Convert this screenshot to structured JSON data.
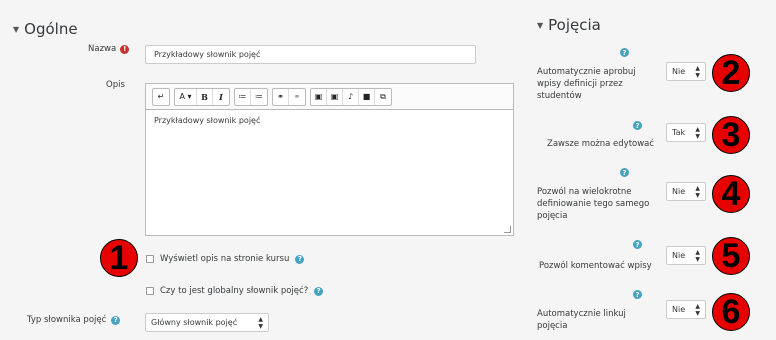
{
  "general": {
    "title": "Ogólne",
    "name_label": "Nazwa",
    "name_value": "Przykładowy słownik pojęć",
    "desc_label": "Opis",
    "desc_value": "Przykładowy słownik pojęć",
    "toolbar": [
      "↵",
      "A ▾",
      "B",
      "I",
      "≔",
      "≔",
      "⚭",
      "⚭",
      "▣",
      "▣",
      "♪",
      "■",
      "⧉"
    ],
    "show_desc_label": "Wyświetl opis na stronie kursu",
    "global_label": "Czy to jest globalny słownik pojęć?",
    "type_label": "Typ słownika pojęć",
    "type_value": "Główny słownik pojęć"
  },
  "entries": {
    "title": "Pojęcia",
    "items": [
      {
        "label": "Automatycznie aprobuj wpisy definicji przez studentów",
        "value": "Nie",
        "badge": "2"
      },
      {
        "label": "Zawsze można edytować",
        "value": "Tak",
        "badge": "3"
      },
      {
        "label": "Pozwól na wielokrotne definiowanie tego samego pojęcia",
        "value": "Nie",
        "badge": "4"
      },
      {
        "label": "Pozwól komentować wpisy",
        "value": "Nie",
        "badge": "5"
      },
      {
        "label": "Automatycznie linkuj pojęcia",
        "value": "Nie",
        "badge": "6"
      }
    ]
  },
  "badge1": "1",
  "colors": {
    "help": "#45a3c2",
    "required": "#c9302c",
    "badge": "#e60000"
  }
}
